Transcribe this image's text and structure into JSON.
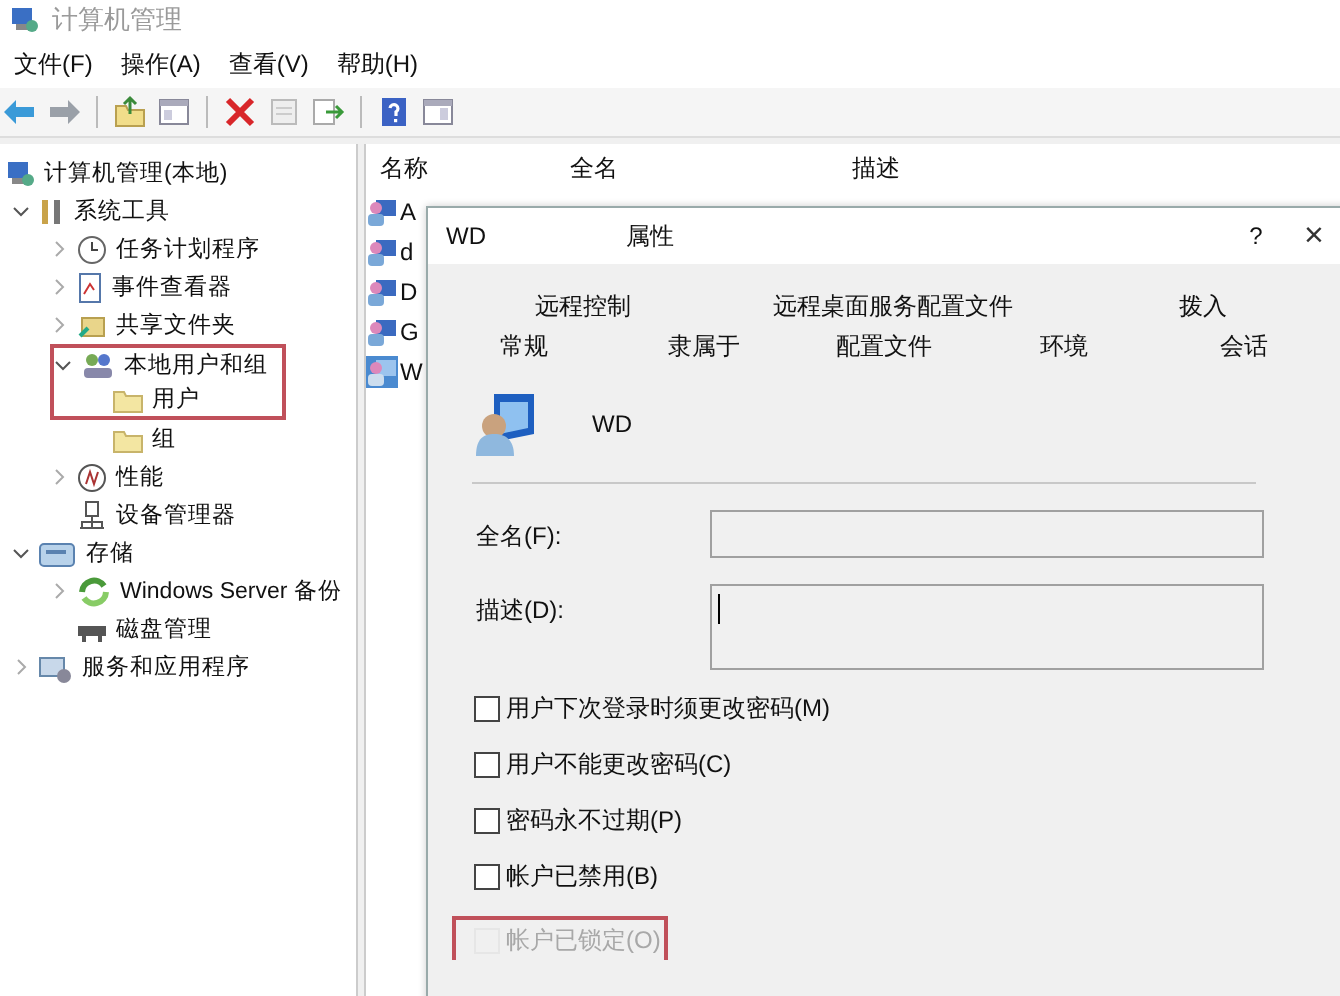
{
  "window": {
    "title": "计算机管理"
  },
  "menu": [
    {
      "label": "文件(F)"
    },
    {
      "label": "操作(A)"
    },
    {
      "label": "查看(V)"
    },
    {
      "label": "帮助(H)"
    }
  ],
  "tree": [
    {
      "label": "计算机管理(本地)",
      "highlighted": false,
      "children": [
        {
          "label": "系统工具",
          "expanded": true,
          "highlighted": false,
          "children": [
            {
              "label": "任务计划程序",
              "expanded": false,
              "highlighted": false
            },
            {
              "label": "事件查看器",
              "expanded": false,
              "highlighted": false
            },
            {
              "label": "共享文件夹",
              "expanded": false,
              "highlighted": false
            },
            {
              "label": "本地用户和组",
              "expanded": true,
              "highlighted": true,
              "children": [
                {
                  "label": "用户",
                  "highlighted": true
                },
                {
                  "label": "组",
                  "highlighted": false
                }
              ]
            },
            {
              "label": "性能",
              "expanded": false,
              "highlighted": false
            },
            {
              "label": "设备管理器",
              "highlighted": false
            }
          ]
        },
        {
          "label": "存储",
          "expanded": true,
          "highlighted": false,
          "children": [
            {
              "label": "Windows Server 备份",
              "expanded": false,
              "highlighted": false
            },
            {
              "label": "磁盘管理",
              "highlighted": false
            }
          ]
        },
        {
          "label": "服务和应用程序",
          "expanded": false,
          "highlighted": false
        }
      ]
    }
  ],
  "list": {
    "columns": [
      "名称",
      "全名",
      "描述"
    ],
    "rows": [
      {
        "name": "A",
        "selected": false
      },
      {
        "name": "d",
        "selected": false
      },
      {
        "name": "D",
        "selected": false
      },
      {
        "name": "G",
        "selected": false
      },
      {
        "name": "W",
        "selected": true
      }
    ]
  },
  "dialog": {
    "title": {
      "name": "WD",
      "suffix": "属性"
    },
    "help": "?",
    "close": "×",
    "tab_rows": [
      [
        {
          "label": "远程控制"
        },
        {
          "label": "远程桌面服务配置文件"
        },
        {
          "label": "拨入"
        }
      ],
      [
        {
          "label": "常规"
        },
        {
          "label": "隶属于"
        },
        {
          "label": "配置文件"
        },
        {
          "label": "环境"
        },
        {
          "label": "会话"
        }
      ]
    ],
    "user_name": "WD",
    "fields": [
      {
        "label": "全名(F):",
        "kind": "line",
        "focused": false
      },
      {
        "label": "描述(D):",
        "kind": "area",
        "focused": true
      }
    ],
    "checkboxes": [
      {
        "label": "用户下次登录时须更改密码(M)",
        "checked": false,
        "disabled": false,
        "highlighted": false
      },
      {
        "label": "用户不能更改密码(C)",
        "checked": false,
        "disabled": false,
        "highlighted": false
      },
      {
        "label": "密码永不过期(P)",
        "checked": false,
        "disabled": false,
        "highlighted": false
      },
      {
        "label": "帐户已禁用(B)",
        "checked": false,
        "disabled": false,
        "highlighted": false
      },
      {
        "label": "帐户已锁定(O)",
        "checked": false,
        "disabled": true,
        "highlighted": true
      }
    ]
  }
}
